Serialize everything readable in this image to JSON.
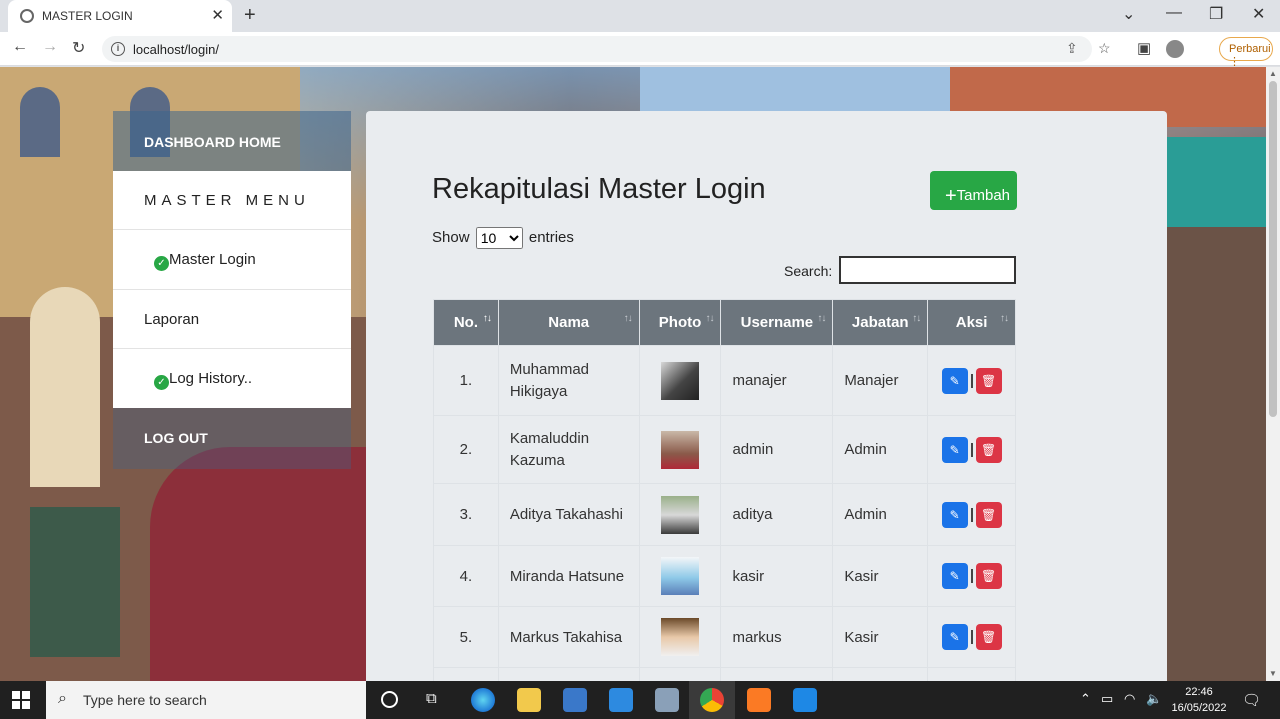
{
  "browser": {
    "tab_title": "MASTER LOGIN",
    "url": "localhost/login/",
    "update_label": "Perbarui"
  },
  "sidebar": {
    "top_link": "DASHBOARD HOME",
    "menu_header": "MASTER MENU",
    "items": [
      {
        "label": "Master Login",
        "checked": true
      },
      {
        "label": "Laporan",
        "checked": false
      },
      {
        "label": "Log History..",
        "checked": true
      }
    ],
    "logout": "LOG OUT"
  },
  "main": {
    "title": "Rekapitulasi Master Login",
    "add_button": "Tambah",
    "show_label": "Show",
    "entries_value": "10",
    "entries_label": "entries",
    "search_label": "Search:",
    "search_value": "",
    "table": {
      "headers": [
        "No.",
        "Nama",
        "Photo",
        "Username",
        "Jabatan",
        "Aksi"
      ],
      "rows": [
        {
          "no": "1.",
          "nama": "Muhammad Hikigaya",
          "username": "manajer",
          "jabatan": "Manajer"
        },
        {
          "no": "2.",
          "nama": "Kamaluddin Kazuma",
          "username": "admin",
          "jabatan": "Admin"
        },
        {
          "no": "3.",
          "nama": "Aditya Takahashi",
          "username": "aditya",
          "jabatan": "Admin"
        },
        {
          "no": "4.",
          "nama": "Miranda Hatsune",
          "username": "kasir",
          "jabatan": "Kasir"
        },
        {
          "no": "5.",
          "nama": "Markus Takahisa",
          "username": "markus",
          "jabatan": "Kasir"
        }
      ]
    }
  },
  "taskbar": {
    "search_placeholder": "Type here to search",
    "time": "22:46",
    "date": "16/05/2022"
  },
  "colors": {
    "add_button": "#28a745",
    "edit_button": "#1a73e8",
    "delete_button": "#dc3545",
    "table_header": "#6c757d",
    "card_bg": "#e9ecef"
  }
}
